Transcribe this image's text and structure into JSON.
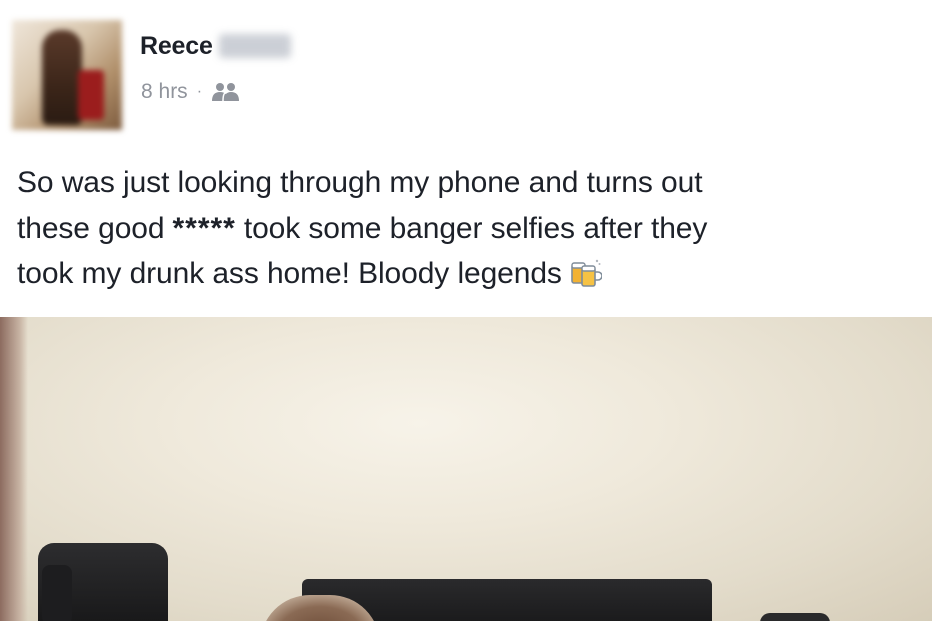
{
  "post": {
    "author": {
      "first_name": "Reece",
      "avatar_icon": "profile-photo-blurred"
    },
    "meta": {
      "time": "8 hrs",
      "separator": "·",
      "audience_icon": "friends-icon"
    },
    "text_lines": [
      "So was just looking through my phone and turns out",
      "these good",
      "*****",
      "took some banger selfies after they",
      "took my drunk ass home! Bloody legends"
    ],
    "emoji_icon": "beer-mugs-emoji",
    "photo_icon": "room-photo"
  }
}
